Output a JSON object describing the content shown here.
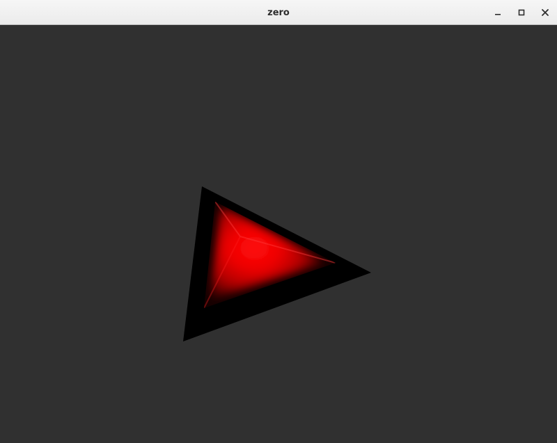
{
  "window": {
    "title": "zero",
    "controls": {
      "minimize_icon": "minimize-icon",
      "maximize_icon": "maximize-icon",
      "close_icon": "close-icon"
    }
  },
  "viewport": {
    "background_color": "#303030",
    "object": {
      "shape": "triangle",
      "face_color": "#ff0000",
      "edge_color": "#000000"
    }
  }
}
